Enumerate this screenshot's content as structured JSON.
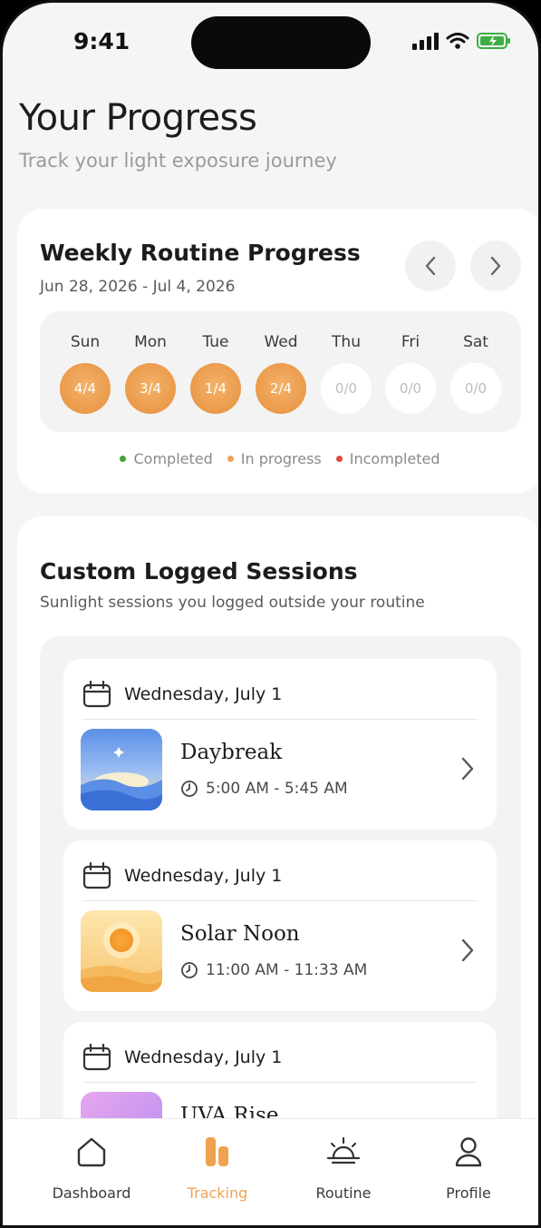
{
  "status_bar": {
    "time": "9:41"
  },
  "header": {
    "title": "Your Progress",
    "subtitle": "Track your light exposure journey"
  },
  "weekly": {
    "title": "Weekly Routine Progress",
    "date_range": "Jun 28, 2026 - Jul 4, 2026",
    "days": [
      {
        "label": "Sun",
        "value": "4/4",
        "state": "in-progress"
      },
      {
        "label": "Mon",
        "value": "3/4",
        "state": "in-progress"
      },
      {
        "label": "Tue",
        "value": "1/4",
        "state": "in-progress"
      },
      {
        "label": "Wed",
        "value": "2/4",
        "state": "in-progress"
      },
      {
        "label": "Thu",
        "value": "0/0",
        "state": "empty"
      },
      {
        "label": "Fri",
        "value": "0/0",
        "state": "empty"
      },
      {
        "label": "Sat",
        "value": "0/0",
        "state": "empty"
      }
    ],
    "legend": [
      {
        "label": "Completed",
        "color": "#3fa33a"
      },
      {
        "label": "In progress",
        "color": "#efa255"
      },
      {
        "label": "Incompleted",
        "color": "#e5473d"
      }
    ]
  },
  "sessions": {
    "title": "Custom Logged Sessions",
    "subtitle": "Sunlight sessions you logged outside your routine",
    "items": [
      {
        "date": "Wednesday, July 1",
        "name": "Daybreak",
        "time": "5:00 AM - 5:45 AM",
        "thumb": "daybreak"
      },
      {
        "date": "Wednesday, July 1",
        "name": "Solar Noon",
        "time": "11:00 AM - 11:33 AM",
        "thumb": "solar-noon"
      },
      {
        "date": "Wednesday, July 1",
        "name": "UVA Rise",
        "time": "",
        "thumb": "uva-rise"
      }
    ]
  },
  "tabbar": {
    "items": [
      {
        "label": "Dashboard",
        "icon": "home-icon"
      },
      {
        "label": "Tracking",
        "icon": "tracking-icon",
        "active": true
      },
      {
        "label": "Routine",
        "icon": "sunrise-icon"
      },
      {
        "label": "Profile",
        "icon": "user-icon"
      }
    ]
  },
  "colors": {
    "accent": "#efa255",
    "accent_fill": "#eb9a4a"
  }
}
